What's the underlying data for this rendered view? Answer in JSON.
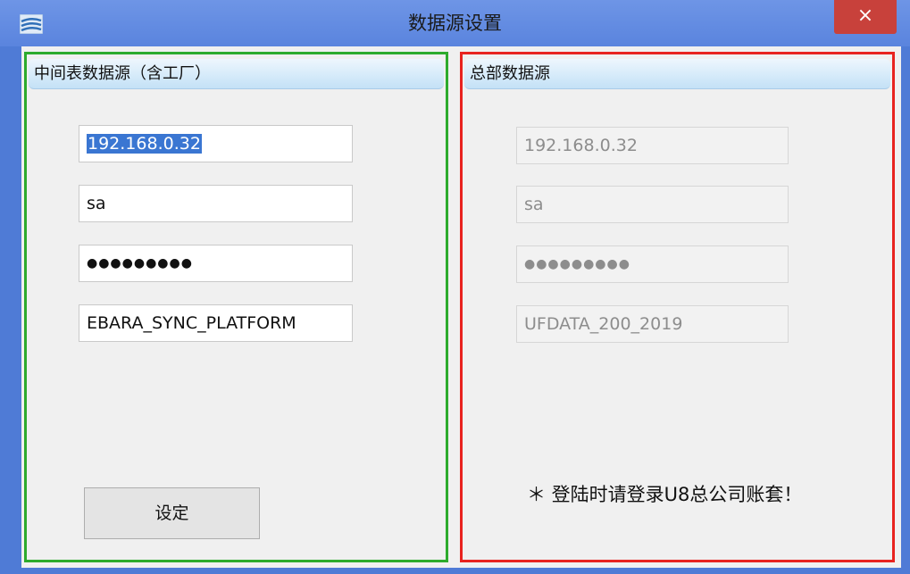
{
  "window": {
    "title": "数据源设置",
    "close_label": "×"
  },
  "left_panel": {
    "header": "中间表数据源（含工厂）",
    "server": "192.168.0.32",
    "user": "sa",
    "password": "●●●●●●●●●",
    "database": "EBARA_SYNC_PLATFORM",
    "set_button_label": "设定"
  },
  "right_panel": {
    "header": "总部数据源",
    "server": "192.168.0.32",
    "user": "sa",
    "password": "●●●●●●●●●",
    "database": "UFDATA_200_2019",
    "note": "＊ 登陆时请登录U8总公司账套！"
  },
  "colors": {
    "left_border": "#2dab2d",
    "right_border": "#e8231f",
    "title_bar": "#5a84de",
    "close_button": "#c8413b"
  },
  "icons": {
    "app": "app-logo-icon",
    "close": "close-icon"
  }
}
